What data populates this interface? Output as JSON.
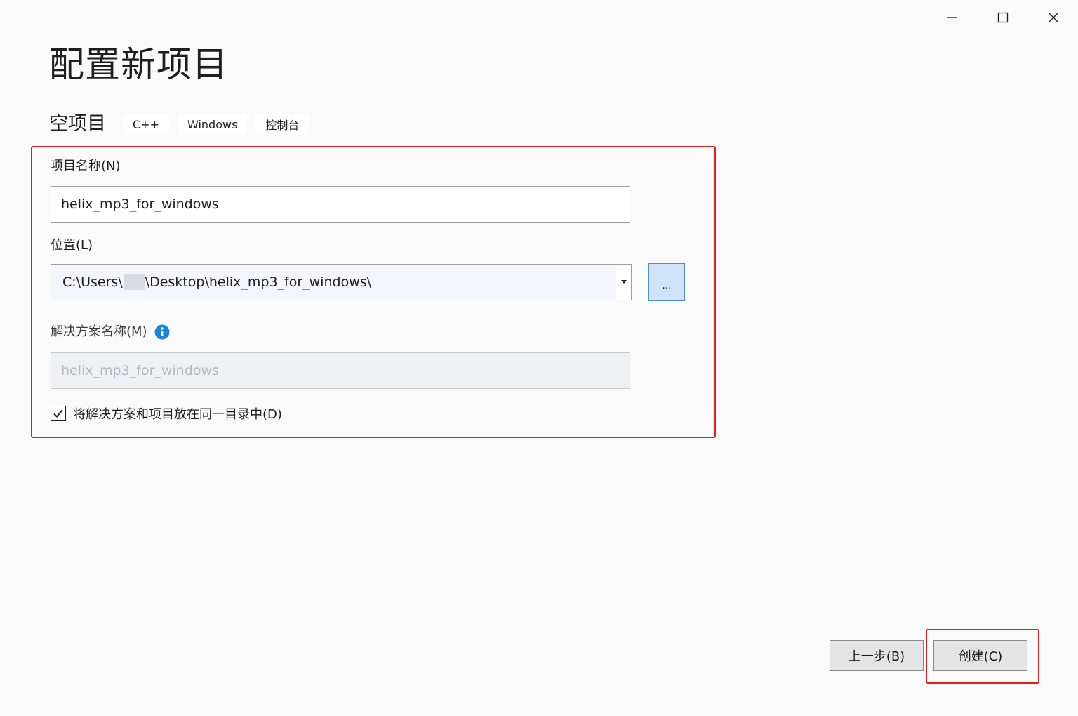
{
  "window": {
    "controls": {
      "minimize_icon": "minimize-icon",
      "maximize_icon": "maximize-icon",
      "close_icon": "close-icon"
    }
  },
  "header": {
    "title": "配置新项目"
  },
  "template": {
    "name": "空项目",
    "tags": [
      "C++",
      "Windows",
      "控制台"
    ]
  },
  "form": {
    "project_name": {
      "label": "项目名称(N)",
      "value": "helix_mp3_for_windows"
    },
    "location": {
      "label": "位置(L)",
      "value_prefix": "C:\\Users\\",
      "value_suffix": "\\Desktop\\helix_mp3_for_windows\\",
      "browse_label": "..."
    },
    "solution_name": {
      "label": "解决方案名称(M)",
      "value": "helix_mp3_for_windows",
      "info_icon": "info-icon"
    },
    "same_directory": {
      "label": "将解决方案和项目放在同一目录中(D)",
      "checked": true
    }
  },
  "footer": {
    "back_label": "上一步(B)",
    "create_label": "创建(C)"
  },
  "colors": {
    "highlight": "#e02020",
    "accent": "#1a86d9",
    "background": "#fafafa"
  }
}
